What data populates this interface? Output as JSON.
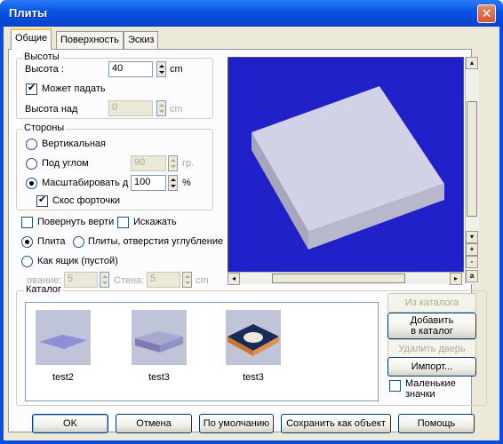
{
  "window": {
    "title": "Плиты",
    "close_glyph": "✕"
  },
  "tabs": [
    {
      "label": "Общие",
      "active": true
    },
    {
      "label": "Поверхность",
      "active": false
    },
    {
      "label": "Эскиз",
      "active": false
    }
  ],
  "heights": {
    "group_label": "Высоты",
    "height_label": "Высота :",
    "height_value": "40",
    "height_unit": "cm",
    "can_fall_label": "Может падать",
    "can_fall_checked": true,
    "height_above_label": "Высота над",
    "height_above_value": "0",
    "height_above_unit": "cm"
  },
  "sides": {
    "group_label": "Стороны",
    "vertical_label": "Вертикальная",
    "angle_label": "Под углом",
    "angle_value": "90",
    "angle_unit": "гр.",
    "scale_label": "Масштабировать д",
    "scale_value": "100",
    "scale_unit": "%",
    "bevel_label": "Скос форточки",
    "bevel_checked": true
  },
  "options": {
    "rotate_label": "Повернуть верти",
    "distort_label": "Искажать",
    "slab_label": "Плита",
    "slabs_holes_label": "Плиты, отверстия углубление",
    "box_label": "Как ящик (пустой)",
    "base_label": "ование:",
    "base_value": "5",
    "wall_label": "Стена:",
    "wall_value": "5",
    "wall_unit": "cm"
  },
  "preview": {
    "background": "#2020c8",
    "zoom_plus": "+",
    "zoom_minus": "-",
    "zoom_auto": "a",
    "scroll_left": "◂",
    "scroll_right": "▸",
    "scroll_up": "▴",
    "scroll_down": "▾"
  },
  "catalog": {
    "group_label": "Каталог",
    "items": [
      {
        "caption": "test2",
        "icon": "flat-slab-thumbnail"
      },
      {
        "caption": "test3",
        "icon": "thick-slab-thumbnail"
      },
      {
        "caption": "test3",
        "icon": "slab-with-hole-thumbnail"
      }
    ],
    "from_catalog": "Из каталога",
    "add_to_catalog_1": "Добавить",
    "add_to_catalog_2": "в каталог",
    "delete_door": "Удалить дверь",
    "import": "Импорт...",
    "small_icons_1": "Маленькие",
    "small_icons_2": "значки"
  },
  "footer": {
    "ok": "OK",
    "cancel": "Отмена",
    "default": "По умолчанию",
    "save_as_object": "Сохранить как объект",
    "help": "Помощь"
  }
}
